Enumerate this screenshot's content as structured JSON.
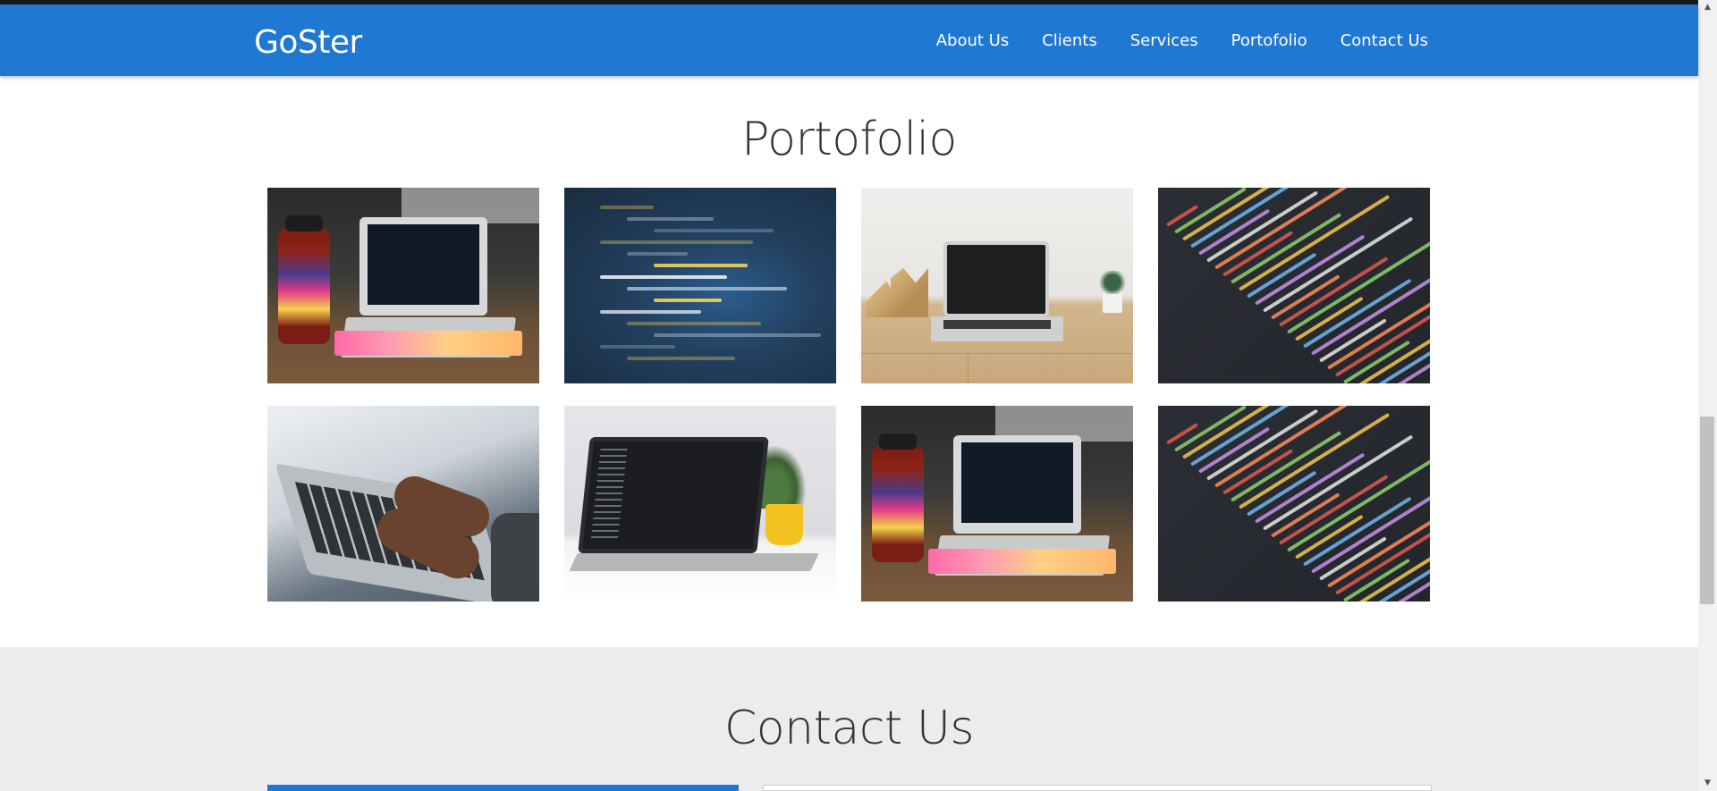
{
  "brand": "GoSter",
  "nav": {
    "items": [
      "About Us",
      "Clients",
      "Services",
      "Portofolio",
      "Contact Us"
    ]
  },
  "portfolio": {
    "title": "Portofolio",
    "images": [
      {
        "icon": "laptop-keyboard-photo"
      },
      {
        "icon": "blue-code-photo"
      },
      {
        "icon": "laptop-desk-photo"
      },
      {
        "icon": "dark-code-photo"
      },
      {
        "icon": "typing-hands-photo"
      },
      {
        "icon": "laptop-plant-photo"
      },
      {
        "icon": "laptop-keyboard-photo"
      },
      {
        "icon": "dark-code-photo"
      }
    ]
  },
  "contact": {
    "title": "Contact Us"
  },
  "colors": {
    "navbar": "#1f78d1",
    "contact_bg": "#ececec"
  }
}
